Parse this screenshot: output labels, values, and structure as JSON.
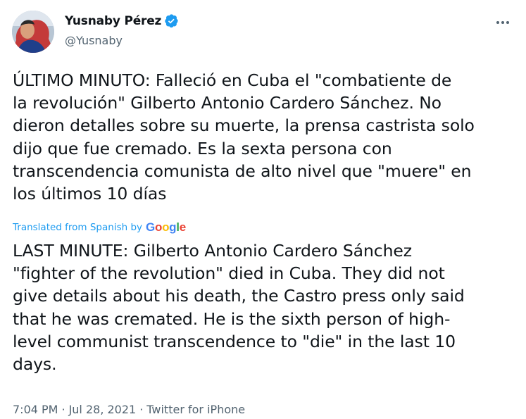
{
  "author": {
    "display_name": "Yusnaby Pérez",
    "handle": "@Yusnaby",
    "verified": true
  },
  "icons": {
    "verified": "verified-badge-icon",
    "more": "more-options-icon",
    "avatar": "avatar-image"
  },
  "colors": {
    "accent": "#1d9bf0",
    "text": "#0f1419",
    "muted": "#536471"
  },
  "tweet": {
    "original_text": "ÚLTIMO MINUTO: Falleció en Cuba el \"combatiente de\nla revolución\" Gilberto Antonio Cardero Sánchez. No\ndieron detalles sobre su muerte, la prensa castrista solo\ndijo que fue cremado. Es la sexta persona con\ntranscendencia comunista de alto nivel que \"muere\" en\nlos últimos 10 días",
    "translated_label": "Translated from Spanish by",
    "translator_brand": [
      "G",
      "o",
      "o",
      "g",
      "l",
      "e"
    ],
    "translated_text": "LAST MINUTE: Gilberto Antonio Cardero Sánchez\n\"fighter of the revolution\" died in Cuba. They did not\ngive details about his death, the Castro press only said\nthat he was cremated. He is the sixth person of high-\nlevel communist transcendence to \"die\" in the last 10\ndays."
  },
  "meta": {
    "time": "7:04 PM",
    "separator": "·",
    "date": "Jul 28, 2021",
    "source": "Twitter for iPhone"
  }
}
